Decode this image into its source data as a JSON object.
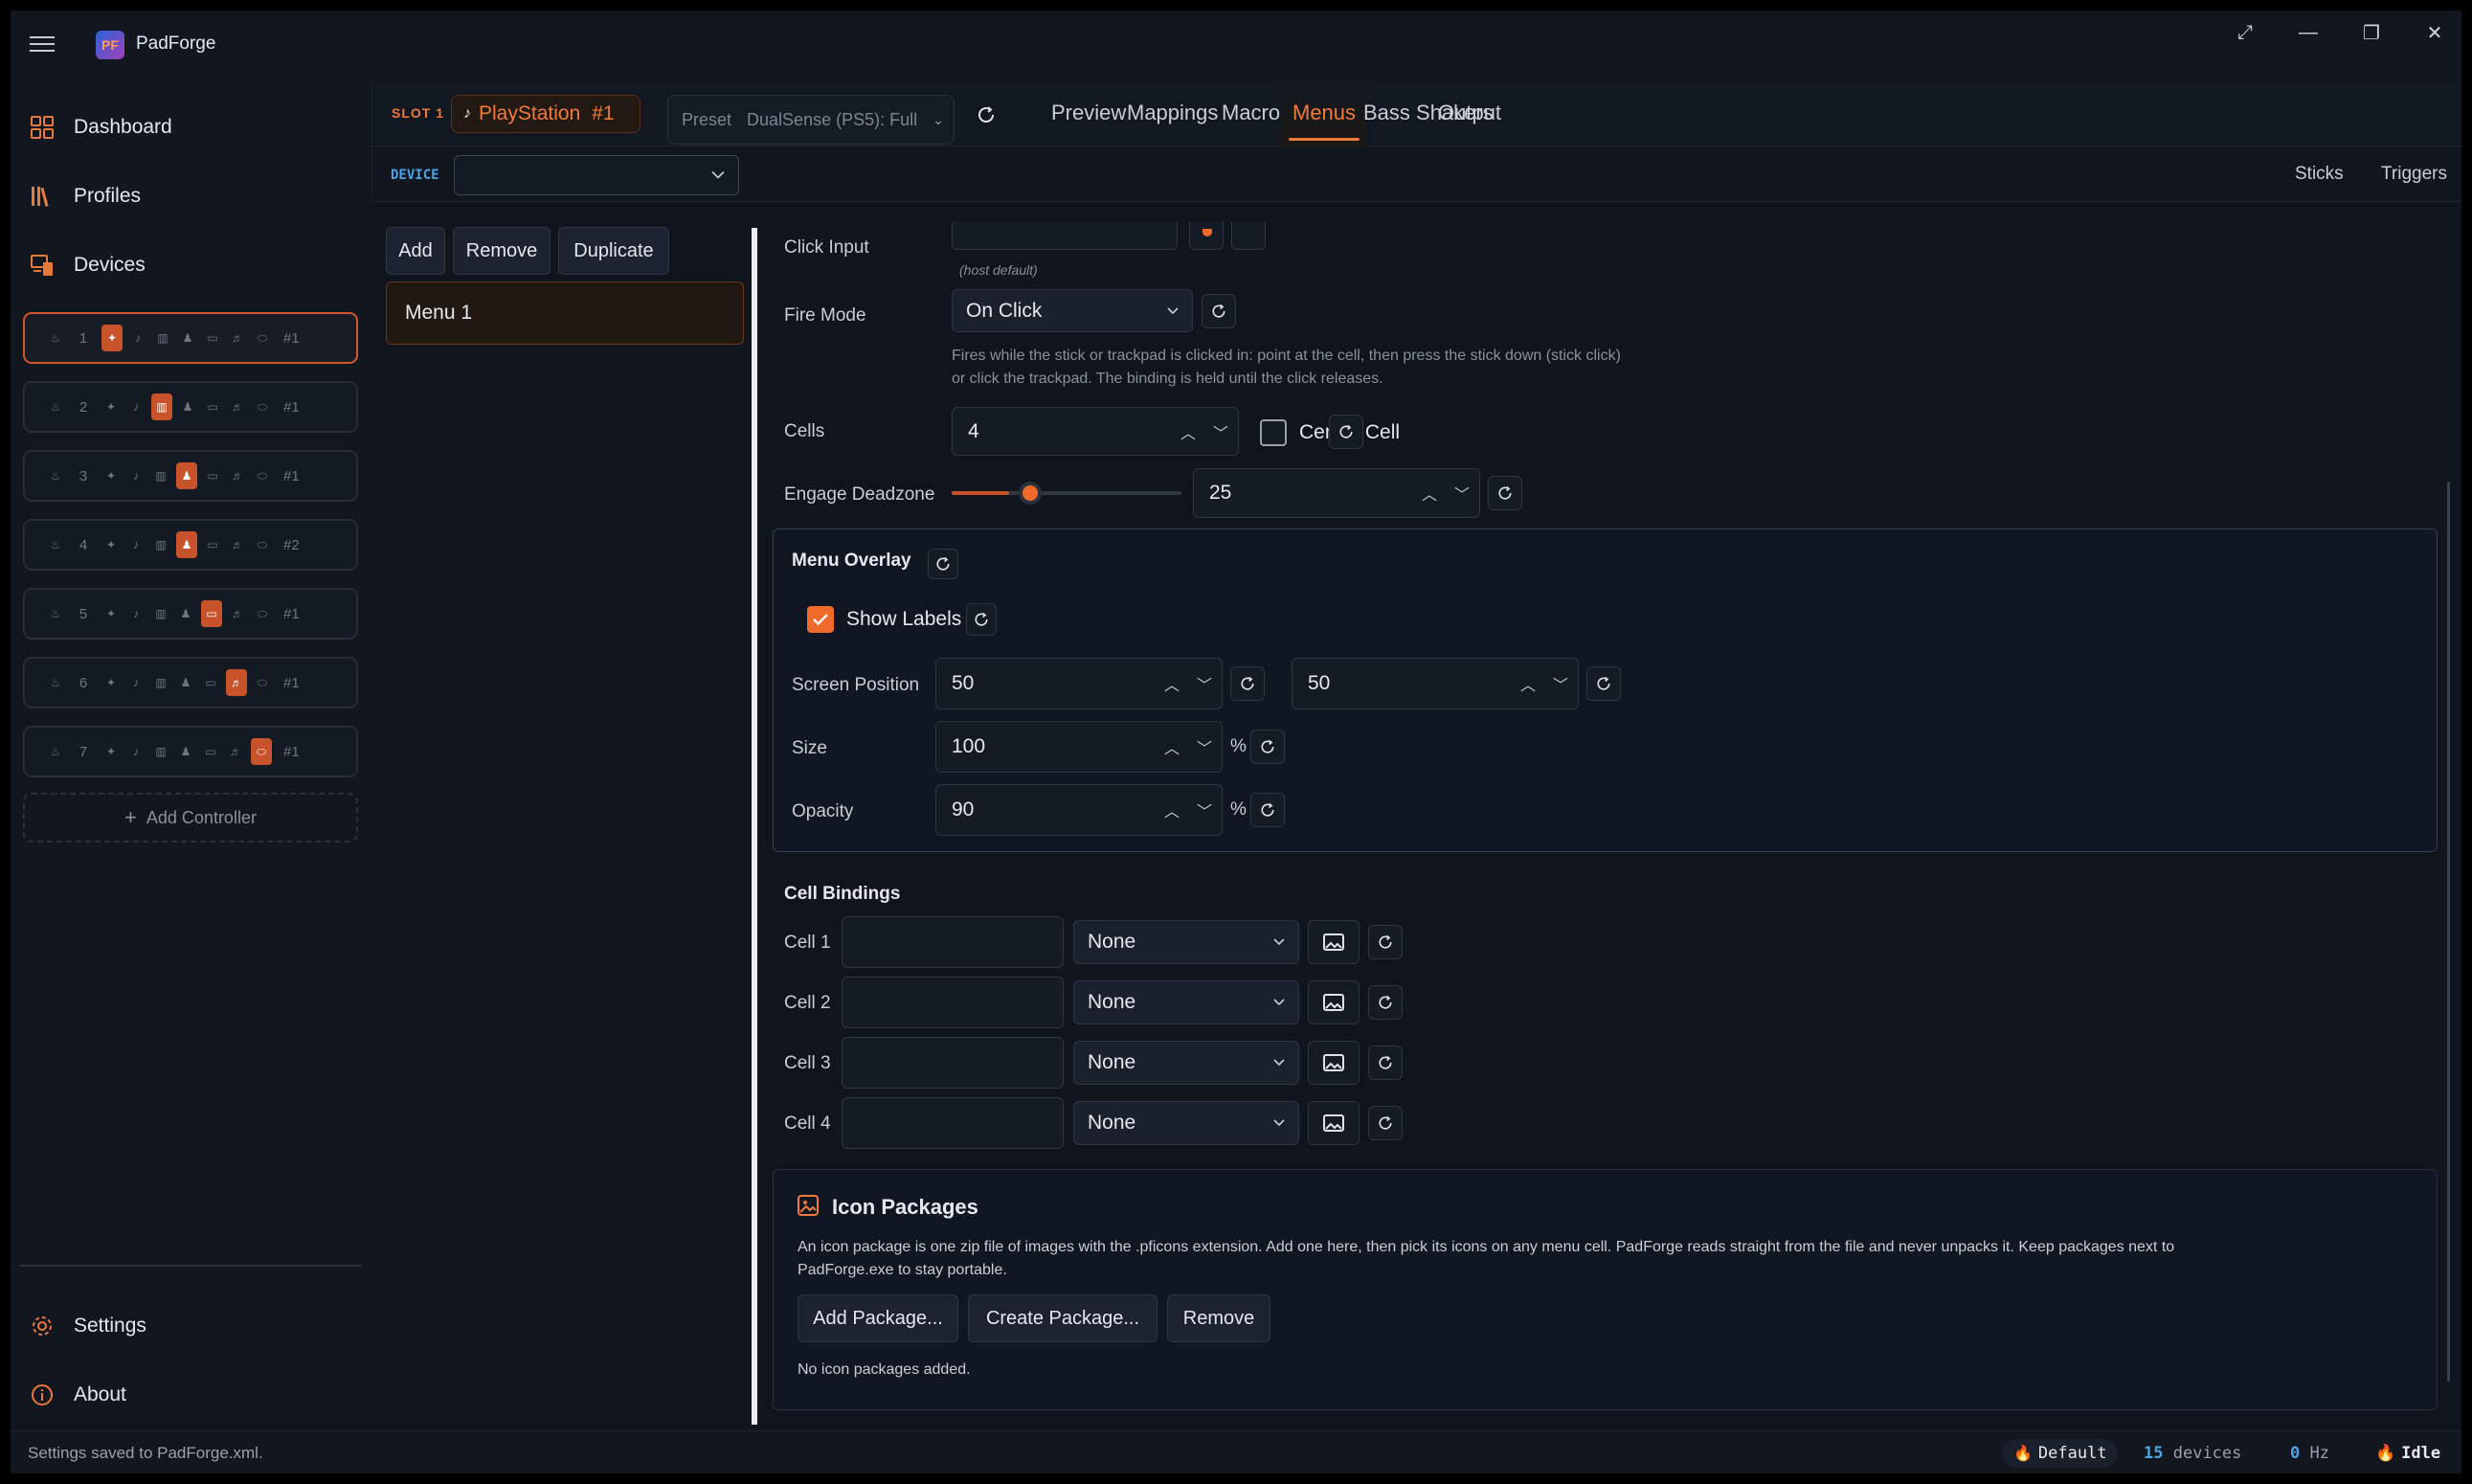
{
  "app": {
    "title": "PadForge",
    "logo_text": "PF"
  },
  "window_controls": {
    "fullscreen": "⤢",
    "minimize": "—",
    "restore": "❐",
    "close": "✕"
  },
  "nav": {
    "dashboard": "Dashboard",
    "profiles": "Profiles",
    "devices": "Devices",
    "settings": "Settings",
    "about": "About"
  },
  "slots": [
    {
      "num": "1",
      "tag": "#1",
      "active_icon": 0
    },
    {
      "num": "2",
      "tag": "#1",
      "active_icon": 2
    },
    {
      "num": "3",
      "tag": "#1",
      "active_icon": 3
    },
    {
      "num": "4",
      "tag": "#2",
      "active_icon": 3
    },
    {
      "num": "5",
      "tag": "#1",
      "active_icon": 4
    },
    {
      "num": "6",
      "tag": "#1",
      "active_icon": 5
    },
    {
      "num": "7",
      "tag": "#1",
      "active_icon": 6
    }
  ],
  "add_controller": "Add Controller",
  "header": {
    "slot_label": "SLOT 1",
    "controller_name": "PlayStation",
    "controller_tag": "#1",
    "preset_label": "Preset",
    "preset_value": "DualSense (PS5): Full"
  },
  "tabs": [
    "Preview",
    "Mappings",
    "Macros",
    "Menus",
    "Bass Shakers",
    "Output"
  ],
  "active_tab": "Menus",
  "device_bar": {
    "label": "DEVICE",
    "value": "",
    "right_tabs": [
      "Sticks",
      "Triggers"
    ]
  },
  "menu_list": {
    "add": "Add",
    "remove": "Remove",
    "duplicate": "Duplicate",
    "items": [
      "Menu 1"
    ]
  },
  "settings": {
    "click_input_label": "Click Input",
    "click_input_hint": "(host default)",
    "fire_mode_label": "Fire Mode",
    "fire_mode_value": "On Click",
    "fire_mode_desc_1": "Fires while the stick or trackpad is clicked in: point at the cell, then press the stick down (stick click)",
    "fire_mode_desc_2": "or click the trackpad. The binding is held until the click releases.",
    "cells_label": "Cells",
    "cells_value": "4",
    "center_cell_label": "Center Cell",
    "center_cell_checked": false,
    "engage_deadzone_label": "Engage Deadzone",
    "engage_deadzone_value": "25",
    "engage_deadzone_fraction": 0.25
  },
  "overlay": {
    "title": "Menu Overlay",
    "show_labels": "Show Labels",
    "show_labels_checked": true,
    "screen_position_label": "Screen Position",
    "screen_position_x": "50",
    "screen_position_y": "50",
    "size_label": "Size",
    "size_value": "100",
    "opacity_label": "Opacity",
    "opacity_value": "90",
    "percent": "%"
  },
  "cell_bindings": {
    "title": "Cell Bindings",
    "rows": [
      {
        "label": "Cell 1",
        "text": "",
        "action": "None"
      },
      {
        "label": "Cell 2",
        "text": "",
        "action": "None"
      },
      {
        "label": "Cell 3",
        "text": "",
        "action": "None"
      },
      {
        "label": "Cell 4",
        "text": "",
        "action": "None"
      }
    ]
  },
  "icon_packages": {
    "title": "Icon Packages",
    "desc_1": "An icon package is one zip file of images with the .pficons extension. Add one here, then pick its icons on any menu cell. PadForge reads straight from the file and never unpacks it. Keep packages next to",
    "desc_2": "PadForge.exe to stay portable.",
    "add": "Add Package...",
    "create": "Create Package...",
    "remove": "Remove",
    "empty": "No icon packages added."
  },
  "status": {
    "message": "Settings saved to PadForge.xml.",
    "profile": "Default",
    "devices_count": "15",
    "devices_label": "devices",
    "hz_value": "0",
    "hz_label": "Hz",
    "state": "Idle"
  },
  "colors": {
    "accent": "#f07a3a",
    "bg": "#0f141d",
    "panel": "#11161f",
    "border": "#2e3644"
  }
}
